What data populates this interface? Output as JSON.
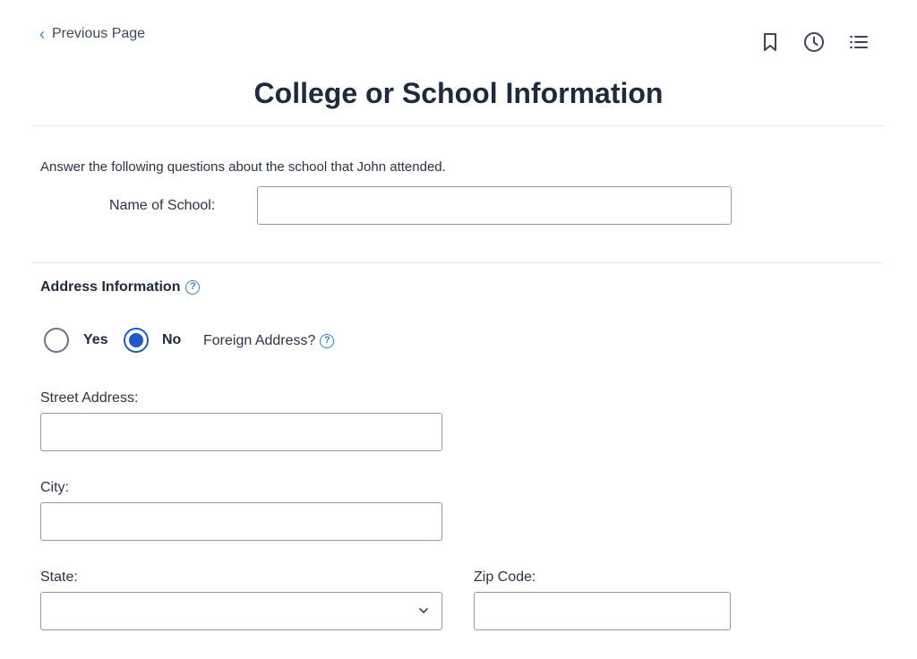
{
  "nav": {
    "previous_label": "Previous Page",
    "previous_icon": "chevron-left-icon",
    "toolbar_icons": [
      "bookmark-icon",
      "clock-icon",
      "list-icon"
    ]
  },
  "header": {
    "title": "College or School Information"
  },
  "school": {
    "intro": "Answer the following questions about the school that John attended.",
    "name_label": "Name of School:",
    "name_value": ""
  },
  "address": {
    "section_title": "Address Information",
    "help_glyph": "?",
    "foreign": {
      "question": "Foreign Address?",
      "options": [
        {
          "label": "Yes",
          "checked": false
        },
        {
          "label": "No",
          "checked": true
        }
      ]
    },
    "street_label": "Street Address:",
    "street_value": "",
    "city_label": "City:",
    "city_value": "",
    "state_label": "State:",
    "state_value": "",
    "zip_label": "Zip Code:",
    "zip_value": ""
  },
  "colors": {
    "accent": "#2259c7",
    "link_icon": "#3a7bd5",
    "title": "#1f2a3c"
  }
}
